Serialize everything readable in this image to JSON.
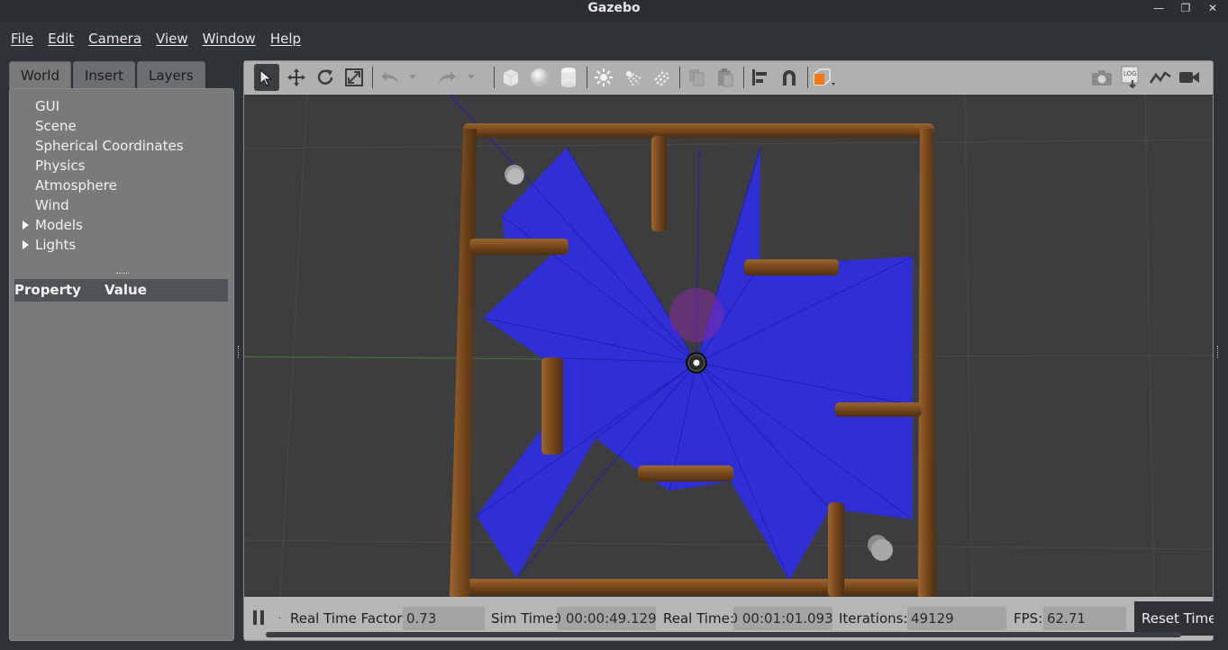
{
  "window": {
    "title": "Gazebo",
    "minimize_icon": "minimize-icon",
    "restore_icon": "restore-icon",
    "close_icon": "close-icon"
  },
  "menu": {
    "items": [
      "File",
      "Edit",
      "Camera",
      "View",
      "Window",
      "Help"
    ]
  },
  "left_panel": {
    "tabs": [
      "World",
      "Insert",
      "Layers"
    ],
    "active_tab": "World",
    "tree": [
      {
        "label": "GUI",
        "expandable": false
      },
      {
        "label": "Scene",
        "expandable": false
      },
      {
        "label": "Spherical Coordinates",
        "expandable": false
      },
      {
        "label": "Physics",
        "expandable": false
      },
      {
        "label": "Atmosphere",
        "expandable": false
      },
      {
        "label": "Wind",
        "expandable": false
      },
      {
        "label": "Models",
        "expandable": true
      },
      {
        "label": "Lights",
        "expandable": true
      }
    ],
    "property_header": {
      "property": "Property",
      "value": "Value"
    }
  },
  "toolbar": {
    "icons": [
      "select-arrow-icon",
      "translate-icon",
      "rotate-icon",
      "scale-icon",
      "undo-icon",
      "undo-dropdown-icon",
      "redo-icon",
      "redo-dropdown-icon",
      "box-shape-icon",
      "sphere-shape-icon",
      "cylinder-shape-icon",
      "point-light-icon",
      "spot-light-icon",
      "directional-light-icon",
      "copy-icon",
      "paste-icon",
      "align-icon",
      "snap-magnet-icon",
      "view-angle-icon",
      "screenshot-icon",
      "log-icon",
      "plot-icon",
      "video-record-icon"
    ]
  },
  "bottom_bar": {
    "real_time_factor_label": "Real Time Factor:",
    "real_time_factor": "0.73",
    "sim_time_label": "Sim Time:",
    "sim_time": "00 00:00:49.129",
    "real_time_label": "Real Time:",
    "real_time": "00 00:01:01.093",
    "iterations_label": "Iterations:",
    "iterations": "49129",
    "fps_label": "FPS:",
    "fps": "62.71",
    "reset_label": "Reset Time"
  },
  "colors": {
    "laser": "#2d2df0",
    "wood": "#7a4a1e",
    "ground": "#3e3e3e",
    "panel": "#7a7a7a"
  }
}
